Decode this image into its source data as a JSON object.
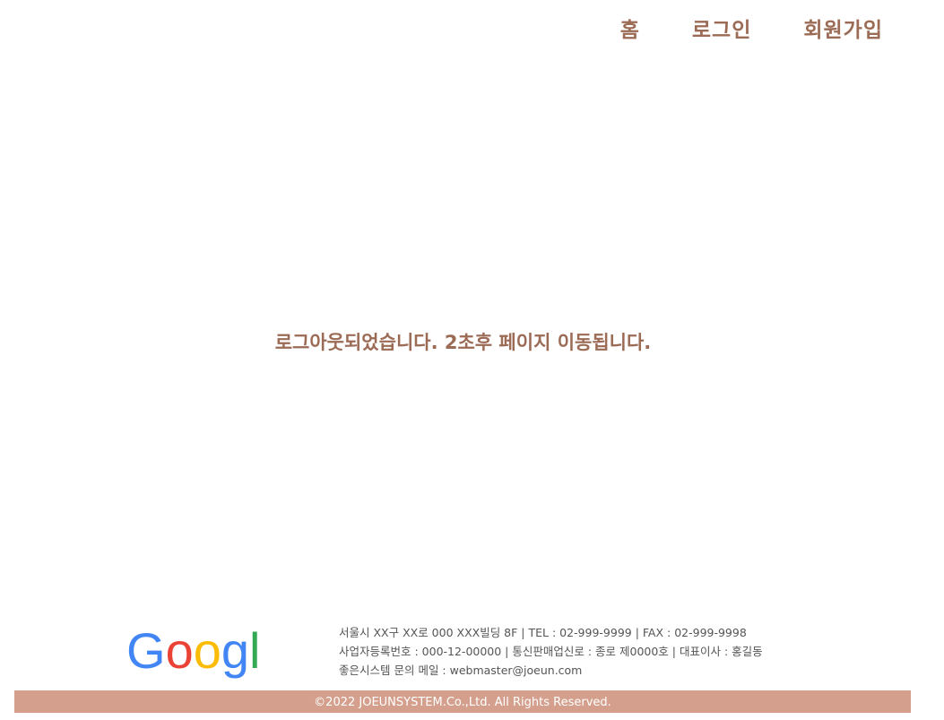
{
  "nav": {
    "items": [
      {
        "label": "홈"
      },
      {
        "label": "로그인"
      },
      {
        "label": "회원가입"
      }
    ]
  },
  "main": {
    "message": "로그아웃되었습니다. 2초후 페이지 이동됩니다."
  },
  "footer": {
    "logo_text": "Google",
    "logo_colors": [
      "#4285F4",
      "#EA4335",
      "#FBBC05",
      "#4285F4",
      "#34A853",
      "#EA4335"
    ],
    "info_lines": [
      "서울시 XX구 XX로 000 XXX빌딩 8F | TEL : 02-999-9999 | FAX : 02-999-9998",
      "사업자등록번호 : 000-12-00000 | 통신판매업신로 : 종로 제0000호 | 대표이사 : 홍길동",
      "좋은시스템 문의 메일 : webmaster@joeun.com"
    ],
    "copyright": "©2022 JOEUNSYSTEM.Co.,Ltd. All Rights Reserved.",
    "bar_color": "#d4a08d"
  },
  "colors": {
    "accent": "#9b6b55"
  }
}
